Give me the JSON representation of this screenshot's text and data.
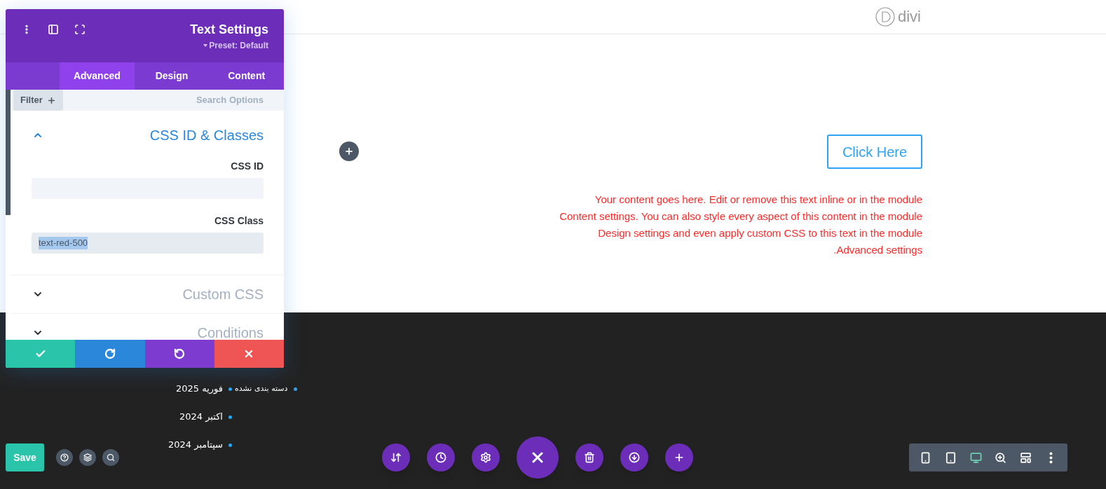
{
  "header": {
    "logo": "divi"
  },
  "panel": {
    "title": "Text Settings",
    "preset": "Preset: Default",
    "tabs": [
      {
        "label": "Advanced",
        "selected": true
      },
      {
        "label": "Design",
        "selected": false
      },
      {
        "label": "Content",
        "selected": false
      }
    ],
    "filter": "Filter",
    "search": {
      "placeholder": "Search Options"
    },
    "sections": [
      {
        "title": "CSS ID & Classes",
        "expanded": true,
        "fields": [
          {
            "label": "CSS ID"
          },
          {
            "label": "CSS Class",
            "value": "text-red-500",
            "highlighted": true
          }
        ]
      },
      {
        "title": "Custom CSS",
        "expanded": false
      },
      {
        "title": "Conditions",
        "expanded": false
      }
    ],
    "footer_buttons": [
      {
        "kind": "save"
      },
      {
        "kind": "redo"
      },
      {
        "kind": "undo"
      },
      {
        "kind": "cancel"
      }
    ]
  },
  "content": {
    "button": "Click Here",
    "text": "Your content goes here. Edit or remove this text inline or in the module Content settings. You can also style every aspect of this content in the module Design settings and even apply custom CSS to this text in the module Advanced settings."
  },
  "footer": {
    "archives": [
      "فوریه 2025",
      "اکتبر 2024",
      "سپتامبر 2024"
    ],
    "categories": [
      "دسته بندی نشده"
    ]
  },
  "bottom_bar": {
    "save": "Save",
    "tools": [
      {
        "kind": "help"
      },
      {
        "kind": "layers"
      },
      {
        "kind": "search"
      }
    ],
    "actions": [
      {
        "kind": "sort"
      },
      {
        "kind": "history"
      },
      {
        "kind": "settings"
      },
      {
        "kind": "close"
      },
      {
        "kind": "delete"
      },
      {
        "kind": "download"
      },
      {
        "kind": "add"
      }
    ],
    "views": [
      {
        "kind": "phone",
        "selected": false
      },
      {
        "kind": "tablet",
        "selected": false
      },
      {
        "kind": "desktop",
        "selected": true
      },
      {
        "kind": "zoom",
        "selected": false
      },
      {
        "kind": "layout",
        "selected": false
      },
      {
        "kind": "more",
        "selected": false
      }
    ]
  }
}
